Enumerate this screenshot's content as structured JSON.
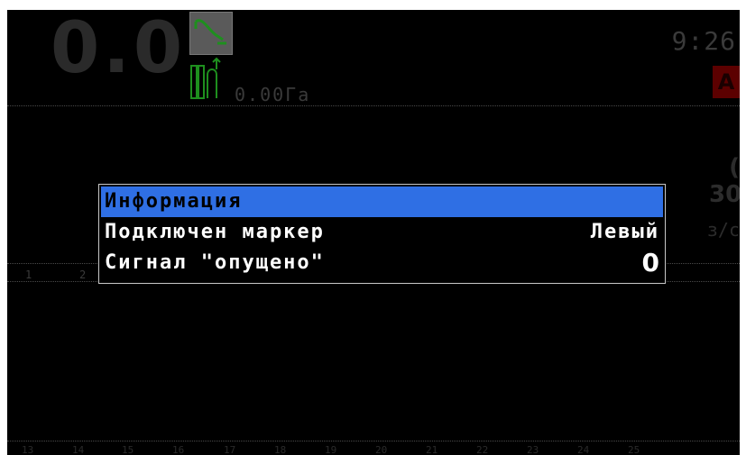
{
  "status": {
    "speed": "0.0",
    "area": "0.00Га",
    "time": "9:26",
    "mode_badge": "A",
    "right_value_1": "(",
    "right_value_2": "30",
    "right_unit": "з/с"
  },
  "lanes": [
    "1",
    "2"
  ],
  "bottom_scale": [
    "13",
    "14",
    "15",
    "16",
    "17",
    "18",
    "19",
    "20",
    "21",
    "22",
    "23",
    "24",
    "25"
  ],
  "dialog": {
    "title": "Информация",
    "rows": [
      {
        "label": "Подключен маркер",
        "value": "Левый"
      },
      {
        "label": "Сигнал \"опущено\"",
        "value": "0"
      }
    ]
  },
  "colors": {
    "background": "#000000",
    "dialog_title_bg": "#2f6fe4",
    "dialog_text": "#ffffff",
    "icon_green": "#1e8f1e",
    "badge_red": "#5c0000"
  },
  "icons": {
    "gps": "gps-signal-icon",
    "implement": "implement-icon"
  }
}
